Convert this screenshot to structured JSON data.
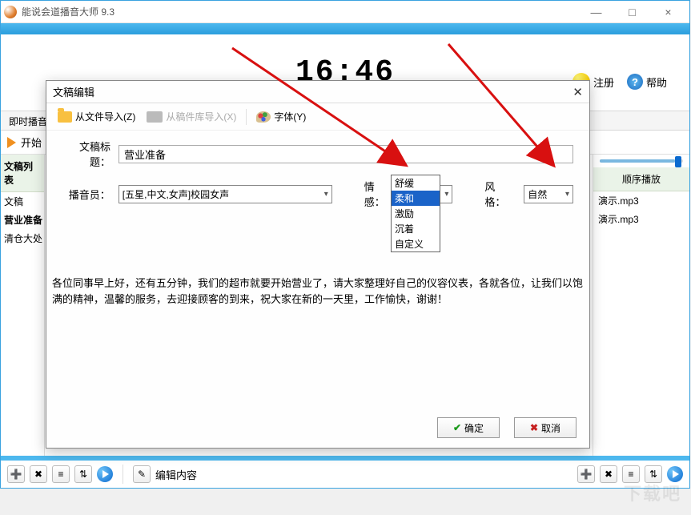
{
  "window": {
    "title": "能说会道播音大师 9.3",
    "min": "—",
    "max": "□",
    "close": "×"
  },
  "clock": "16:46",
  "header_links": {
    "register": "注册",
    "help": "帮助",
    "help_q": "?"
  },
  "tabs": {
    "instant": "即时播音"
  },
  "play_row": {
    "start": "开始"
  },
  "left_panel": {
    "heading": "文稿列表",
    "items": [
      "文稿",
      "营业准备",
      "清仓大处"
    ]
  },
  "right_panel": {
    "button": "顺序播放",
    "files": [
      "演示.mp3",
      "演示.mp3"
    ]
  },
  "bottom": {
    "edit_label": "编辑内容"
  },
  "dialog": {
    "title": "文稿编辑",
    "close": "✕",
    "toolbar": {
      "import_file": "从文件导入(Z)",
      "import_lib": "从稿件库导入(X)",
      "font": "字体(Y)"
    },
    "labels": {
      "doc_title": "文稿标题：",
      "announcer": "播音员：",
      "emotion": "情感：",
      "style": "风格："
    },
    "values": {
      "doc_title": "营业准备",
      "announcer": "[五星,中文,女声]校园女声",
      "emotion_selected": "柔和",
      "style_selected": "自然"
    },
    "emotion_options": [
      "舒缓",
      "柔和",
      "激励",
      "沉着",
      "自定义"
    ],
    "body_text": "各位同事早上好，还有五分钟，我们的超市就要开始营业了，请大家整理好自己的仪容仪表，各就各位，让我们以饱满的精神，温馨的服务，去迎接顾客的到来，祝大家在新的一天里，工作愉快，谢谢！",
    "buttons": {
      "ok": "确定",
      "cancel": "取消"
    }
  },
  "watermark": "下载吧"
}
